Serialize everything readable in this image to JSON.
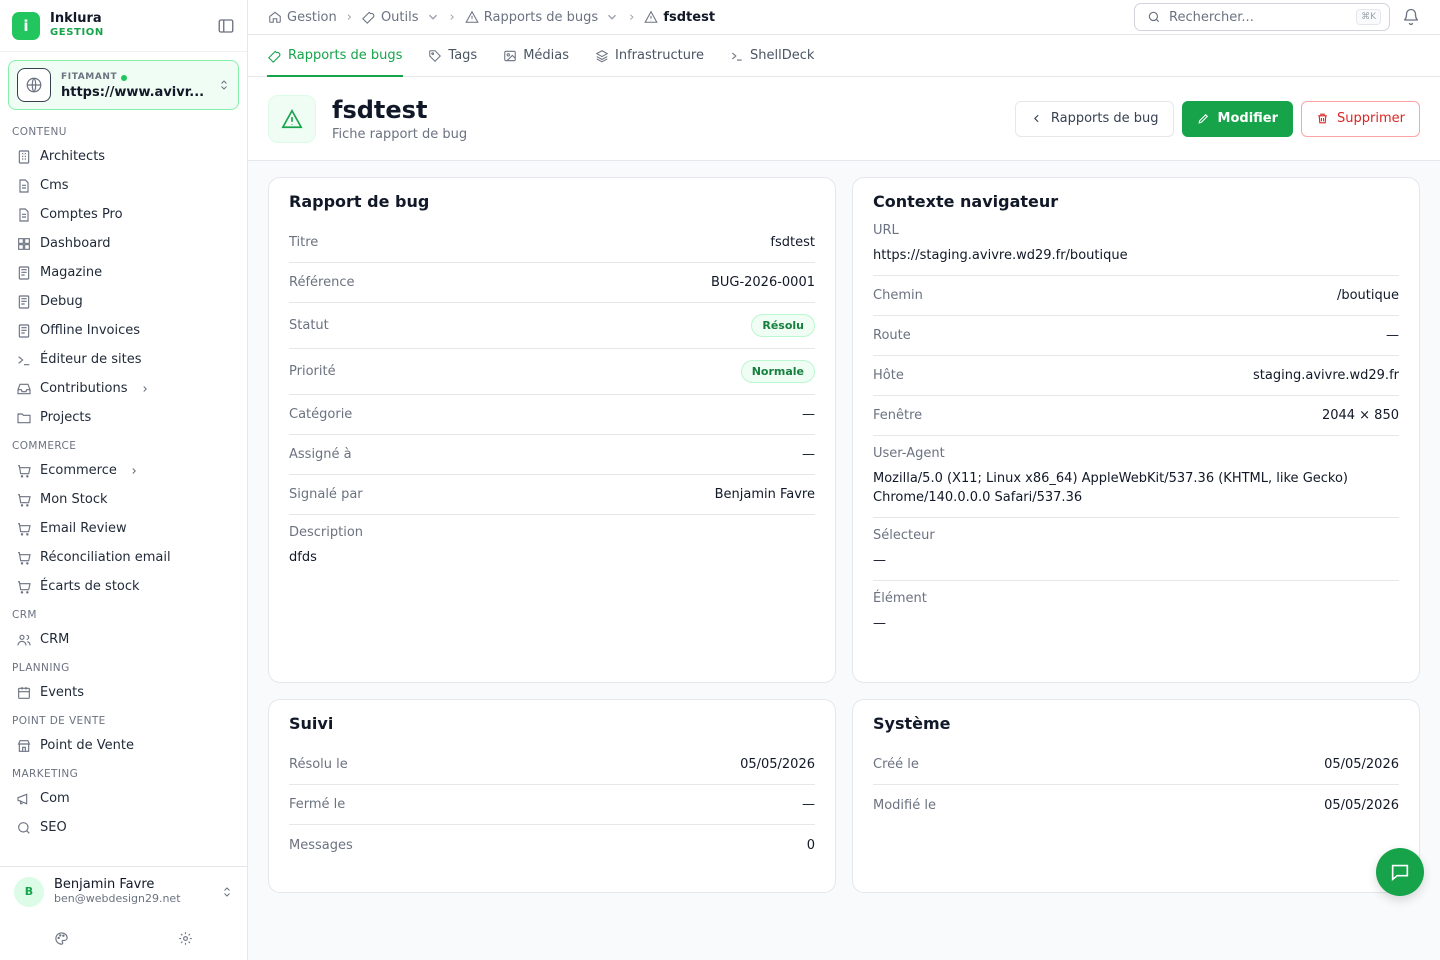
{
  "brand": {
    "name": "Inklura",
    "sub": "GESTION",
    "logo_letter": "i"
  },
  "tenant": {
    "label": "FITAMANT",
    "url": "https://www.avivr..."
  },
  "nav": {
    "sections": [
      {
        "title": "CONTENU",
        "items": [
          {
            "label": "Architects",
            "icon": "building-icon"
          },
          {
            "label": "Cms",
            "icon": "file-icon"
          },
          {
            "label": "Comptes Pro",
            "icon": "file-icon"
          },
          {
            "label": "Dashboard",
            "icon": "grid-icon"
          },
          {
            "label": "Magazine",
            "icon": "book-icon"
          },
          {
            "label": "Debug",
            "icon": "book-icon"
          },
          {
            "label": "Offline Invoices",
            "icon": "book-icon"
          },
          {
            "label": "Éditeur de sites",
            "icon": "terminal-icon"
          },
          {
            "label": "Contributions",
            "icon": "inbox-icon",
            "has_children": true
          },
          {
            "label": "Projects",
            "icon": "folder-icon"
          }
        ]
      },
      {
        "title": "COMMERCE",
        "items": [
          {
            "label": "Ecommerce",
            "icon": "cart-icon",
            "has_children": true
          },
          {
            "label": "Mon Stock",
            "icon": "cart-icon"
          },
          {
            "label": "Email Review",
            "icon": "cart-icon"
          },
          {
            "label": "Réconciliation email",
            "icon": "cart-icon"
          },
          {
            "label": "Écarts de stock",
            "icon": "cart-icon"
          }
        ]
      },
      {
        "title": "CRM",
        "items": [
          {
            "label": "CRM",
            "icon": "users-icon"
          }
        ]
      },
      {
        "title": "PLANNING",
        "items": [
          {
            "label": "Events",
            "icon": "calendar-icon"
          }
        ]
      },
      {
        "title": "POINT DE VENTE",
        "items": [
          {
            "label": "Point de Vente",
            "icon": "store-icon"
          }
        ]
      },
      {
        "title": "MARKETING",
        "items": [
          {
            "label": "Com",
            "icon": "megaphone-icon"
          },
          {
            "label": "SEO",
            "icon": "search-icon"
          }
        ]
      }
    ]
  },
  "user": {
    "initial": "B",
    "name": "Benjamin Favre",
    "email": "ben@webdesign29.net"
  },
  "breadcrumb": {
    "home": "Gestion",
    "tools": "Outils",
    "reports": "Rapports de bugs",
    "current": "fsdtest"
  },
  "search": {
    "placeholder": "Rechercher...",
    "shortcut": "⌘K"
  },
  "tabs": [
    {
      "label": "Rapports de bugs",
      "active": true
    },
    {
      "label": "Tags"
    },
    {
      "label": "Médias"
    },
    {
      "label": "Infrastructure"
    },
    {
      "label": "ShellDeck"
    }
  ],
  "header": {
    "title": "fsdtest",
    "subtitle": "Fiche rapport de bug",
    "back_label": "Rapports de bug",
    "edit_label": "Modifier",
    "delete_label": "Supprimer"
  },
  "bug_report": {
    "title": "Rapport de bug",
    "rows": {
      "titre": {
        "label": "Titre",
        "value": "fsdtest"
      },
      "reference": {
        "label": "Référence",
        "value": "BUG-2026-0001"
      },
      "statut": {
        "label": "Statut",
        "value": "Résolu"
      },
      "priorite": {
        "label": "Priorité",
        "value": "Normale"
      },
      "categorie": {
        "label": "Catégorie",
        "value": "—"
      },
      "assigne": {
        "label": "Assigné à",
        "value": "—"
      },
      "signale": {
        "label": "Signalé par",
        "value": "Benjamin Favre"
      },
      "description": {
        "label": "Description",
        "value": "dfds"
      }
    }
  },
  "browser": {
    "title": "Contexte navigateur",
    "rows": {
      "url": {
        "label": "URL",
        "value": "https://staging.avivre.wd29.fr/boutique"
      },
      "chemin": {
        "label": "Chemin",
        "value": "/boutique"
      },
      "route": {
        "label": "Route",
        "value": "—"
      },
      "hote": {
        "label": "Hôte",
        "value": "staging.avivre.wd29.fr"
      },
      "fenetre": {
        "label": "Fenêtre",
        "value": "2044 × 850"
      },
      "user_agent": {
        "label": "User-Agent",
        "value": "Mozilla/5.0 (X11; Linux x86_64) AppleWebKit/537.36 (KHTML, like Gecko) Chrome/140.0.0.0 Safari/537.36"
      },
      "selecteur": {
        "label": "Sélecteur",
        "value": "—"
      },
      "element": {
        "label": "Élément",
        "value": "—"
      }
    }
  },
  "suivi": {
    "title": "Suivi",
    "rows": {
      "resolu": {
        "label": "Résolu le",
        "value": "05/05/2026"
      },
      "ferme": {
        "label": "Fermé le",
        "value": "—"
      },
      "messages": {
        "label": "Messages",
        "value": "0"
      }
    }
  },
  "systeme": {
    "title": "Système",
    "rows": {
      "cree": {
        "label": "Créé le",
        "value": "05/05/2026"
      },
      "modifie": {
        "label": "Modifié le",
        "value": "05/05/2026"
      }
    }
  },
  "colors": {
    "accent": "#16a34a",
    "danger": "#dc2626",
    "badge_bg": "#f0fdf4"
  }
}
